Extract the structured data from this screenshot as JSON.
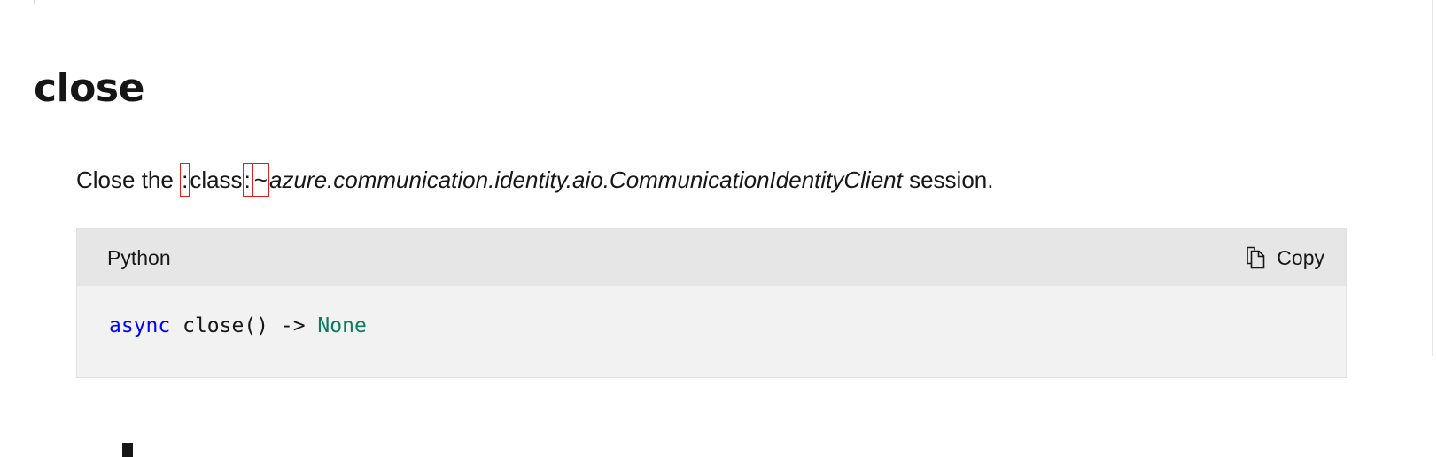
{
  "member": {
    "title": "close"
  },
  "summary": {
    "prefix": "Close the ",
    "colon_1": ":",
    "role_word": "class",
    "colon_2": ":",
    "tilde": "~",
    "target": "azure.communication.identity.aio.CommunicationIdentityClient",
    "suffix": " session."
  },
  "code_block": {
    "language": "Python",
    "copy_label": "Copy",
    "copy_icon": "copy-icon",
    "code": {
      "keyword": "async",
      "signature": " close() -> ",
      "return_type": "None"
    }
  },
  "colors": {
    "keyword": "#0101fd",
    "type": "#0a7d5e",
    "highlight_box": "#e02020",
    "code_header": "#e6e6e6",
    "code_body": "#f2f2f2"
  }
}
